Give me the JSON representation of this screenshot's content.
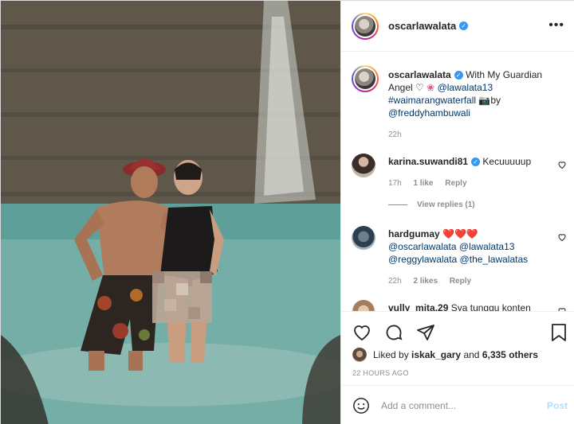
{
  "post": {
    "username": "oscarlawalata",
    "verified": true,
    "more_icon": "more-horizontal-icon"
  },
  "caption": {
    "username": "oscarlawalata",
    "text_1": "With My Guardian Angel",
    "emoji_heart": "♡",
    "emoji_flower": "❀",
    "mention_1": "@lawalata13",
    "hashtag": "#waimarangwaterfall",
    "emoji_camera": "📷",
    "by_text": "by",
    "mention_2": "@freddyhambuwali",
    "time": "22h"
  },
  "comments": [
    {
      "username": "karina.suwandi81",
      "verified": true,
      "text": "Kecuuuuup",
      "time": "17h",
      "likes": "1 like",
      "reply_label": "Reply",
      "view_replies": "View replies (1)"
    },
    {
      "username": "hardgumay",
      "hearts": "❤️❤️❤️",
      "mentions": "@oscarlawalata @lawalata13 @reggylawalata @the_lawalatas",
      "time": "22h",
      "likes": "2 likes",
      "reply_label": "Reply"
    },
    {
      "username": "vully_mita.29",
      "text": "Sya tunggu konten"
    }
  ],
  "actions": {
    "like_icon": "heart-icon",
    "comment_icon": "comment-icon",
    "share_icon": "paper-plane-icon",
    "save_icon": "bookmark-icon"
  },
  "likes": {
    "prefix": "Liked by",
    "user": "iskak_gary",
    "and": "and",
    "others": "6,335 others"
  },
  "timestamp": "22 HOURS AGO",
  "add_comment": {
    "placeholder": "Add a comment...",
    "post_label": "Post",
    "emoji_icon": "smiley-icon"
  }
}
